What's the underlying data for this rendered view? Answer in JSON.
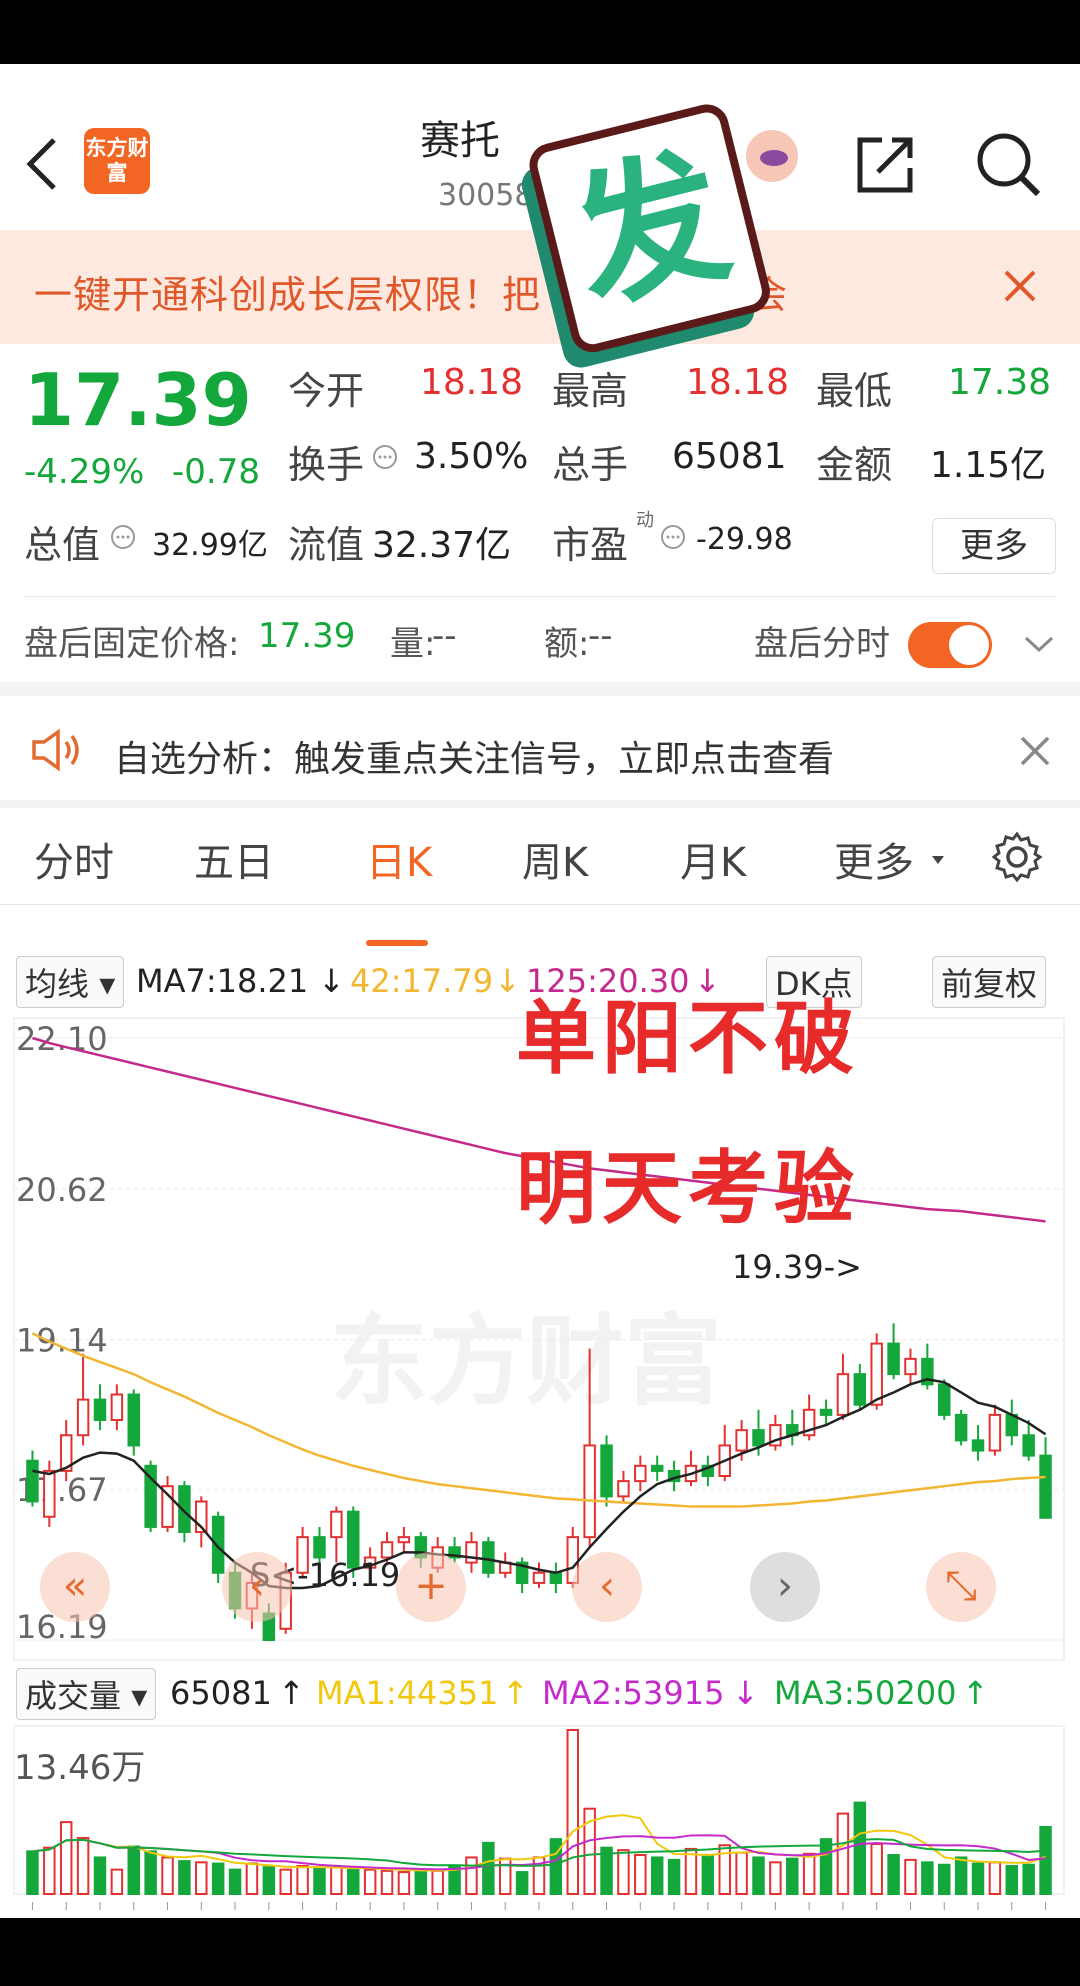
{
  "header": {
    "brand_text": "东方财富",
    "stock_name": "赛托",
    "stock_code": "30058"
  },
  "banner": {
    "text": "一键开通科创成长层权限！把 新、交易机会"
  },
  "quote": {
    "price": "17.39",
    "change_pct": "-4.29%",
    "change_amt": "-0.78",
    "open_label": "今开",
    "open_value": "18.18",
    "high_label": "最高",
    "high_value": "18.18",
    "low_label": "最低",
    "low_value": "17.38",
    "turnover_label": "换手",
    "turnover_value": "3.50%",
    "volume_label": "总手",
    "volume_value": "65081",
    "amount_label": "金额",
    "amount_value": "1.15亿",
    "mktcap_label": "总值",
    "mktcap_value": "32.99亿",
    "float_label": "流值",
    "float_value": "32.37亿",
    "pe_label": "市盈",
    "pe_sup": "动",
    "pe_value": "-29.98",
    "more_label": "更多"
  },
  "after_hours": {
    "price_label": "盘后固定价格:",
    "price_value": "17.39",
    "vol_label": "量:",
    "vol_value": "--",
    "amt_label": "额:",
    "amt_value": "--",
    "timeshare_label": "盘后分时",
    "toggle_on": true
  },
  "notice": {
    "text": "自选分析：触发重点关注信号，立即点击查看"
  },
  "tabs": [
    "分时",
    "五日",
    "日K",
    "周K",
    "月K",
    "更多"
  ],
  "active_tab": "日K",
  "ma_bar": {
    "selector": "均线",
    "ma7": "MA7:18.21",
    "ma42": "42:17.79",
    "ma125": "125:20.30",
    "dk": "DK点",
    "adjust": "前复权"
  },
  "overlay": {
    "line1": "单阳不破",
    "line2": "明天考验",
    "watermark": "东方财富",
    "sticker_text": "发"
  },
  "annotations": {
    "high_label": "19.39->",
    "low_label": "S<-16.19"
  },
  "vol_bar": {
    "selector": "成交量",
    "vol": "65081",
    "ma1": "MA1:44351",
    "ma2": "MA2:53915",
    "ma3": "MA3:50200",
    "max_label": "13.46万"
  },
  "colors": {
    "up": "#e33131",
    "down": "#14a73b",
    "accent": "#f26522",
    "ma7": "#222222",
    "ma42": "#f2b632",
    "ma125": "#c42a8c"
  },
  "chart_data": {
    "type": "candlestick",
    "ylim": [
      16.19,
      22.1
    ],
    "yticks": [
      "22.10",
      "20.62",
      "19.14",
      "17.67",
      "16.19"
    ],
    "candles": [
      [
        17.95,
        17.55,
        18.05,
        17.5
      ],
      [
        17.4,
        17.85,
        17.95,
        17.3
      ],
      [
        17.85,
        18.2,
        18.35,
        17.75
      ],
      [
        18.2,
        18.55,
        19.0,
        18.1
      ],
      [
        18.55,
        18.35,
        18.7,
        18.25
      ],
      [
        18.35,
        18.6,
        18.7,
        18.25
      ],
      [
        18.6,
        18.1,
        18.65,
        18.0
      ],
      [
        17.9,
        17.3,
        17.95,
        17.25
      ],
      [
        17.3,
        17.7,
        17.8,
        17.25
      ],
      [
        17.7,
        17.25,
        17.75,
        17.15
      ],
      [
        17.25,
        17.55,
        17.6,
        17.1
      ],
      [
        17.4,
        16.85,
        17.45,
        16.75
      ],
      [
        16.85,
        16.5,
        16.95,
        16.4
      ],
      [
        16.5,
        16.75,
        16.85,
        16.3
      ],
      [
        16.45,
        16.19,
        16.55,
        16.19
      ],
      [
        16.3,
        16.85,
        16.95,
        16.25
      ],
      [
        16.85,
        17.2,
        17.3,
        16.8
      ],
      [
        17.2,
        17.0,
        17.3,
        16.85
      ],
      [
        17.2,
        17.45,
        17.5,
        16.95
      ],
      [
        17.45,
        16.9,
        17.5,
        16.8
      ],
      [
        16.9,
        17.0,
        17.1,
        16.85
      ],
      [
        17.0,
        17.15,
        17.25,
        16.95
      ],
      [
        17.15,
        17.2,
        17.3,
        17.05
      ],
      [
        17.2,
        17.0,
        17.25,
        16.9
      ],
      [
        16.9,
        17.1,
        17.2,
        16.85
      ],
      [
        17.1,
        17.0,
        17.2,
        16.95
      ],
      [
        16.95,
        17.15,
        17.25,
        16.85
      ],
      [
        17.15,
        16.85,
        17.2,
        16.8
      ],
      [
        16.85,
        16.95,
        17.05,
        16.8
      ],
      [
        16.95,
        16.75,
        17.0,
        16.65
      ],
      [
        16.75,
        16.85,
        16.95,
        16.7
      ],
      [
        16.85,
        16.75,
        16.95,
        16.65
      ],
      [
        16.75,
        17.2,
        17.3,
        16.7
      ],
      [
        17.2,
        18.1,
        19.05,
        17.1
      ],
      [
        18.1,
        17.6,
        18.2,
        17.5
      ],
      [
        17.6,
        17.75,
        17.85,
        17.55
      ],
      [
        17.75,
        17.9,
        18.0,
        17.65
      ],
      [
        17.9,
        17.85,
        18.0,
        17.75
      ],
      [
        17.85,
        17.75,
        17.95,
        17.65
      ],
      [
        17.75,
        17.9,
        18.05,
        17.7
      ],
      [
        17.9,
        17.8,
        18.0,
        17.7
      ],
      [
        17.8,
        18.1,
        18.3,
        17.75
      ],
      [
        18.05,
        18.25,
        18.35,
        17.95
      ],
      [
        18.25,
        18.1,
        18.45,
        18.0
      ],
      [
        18.1,
        18.3,
        18.4,
        18.05
      ],
      [
        18.3,
        18.2,
        18.45,
        18.1
      ],
      [
        18.2,
        18.45,
        18.6,
        18.15
      ],
      [
        18.45,
        18.4,
        18.55,
        18.3
      ],
      [
        18.4,
        18.8,
        19.0,
        18.35
      ],
      [
        18.8,
        18.5,
        18.9,
        18.45
      ],
      [
        18.5,
        19.1,
        19.2,
        18.45
      ],
      [
        19.1,
        18.8,
        19.3,
        18.75
      ],
      [
        18.8,
        18.95,
        19.05,
        18.7
      ],
      [
        18.95,
        18.7,
        19.1,
        18.65
      ],
      [
        18.7,
        18.4,
        18.75,
        18.35
      ],
      [
        18.4,
        18.15,
        18.45,
        18.1
      ],
      [
        18.15,
        18.05,
        18.3,
        17.95
      ],
      [
        18.05,
        18.4,
        18.5,
        18.0
      ],
      [
        18.4,
        18.2,
        18.55,
        18.1
      ],
      [
        18.2,
        18.0,
        18.35,
        17.95
      ],
      [
        18.0,
        17.39,
        18.18,
        17.38
      ]
    ],
    "ma7": [
      17.85,
      17.82,
      17.88,
      17.98,
      18.03,
      18.02,
      17.95,
      17.78,
      17.62,
      17.45,
      17.3,
      17.1,
      16.95,
      16.85,
      16.72,
      16.7,
      16.7,
      16.72,
      16.8,
      16.88,
      16.92,
      16.98,
      17.05,
      17.05,
      17.03,
      17.02,
      17.0,
      16.98,
      16.95,
      16.92,
      16.88,
      16.85,
      16.9,
      17.1,
      17.28,
      17.45,
      17.6,
      17.72,
      17.78,
      17.82,
      17.88,
      17.95,
      18.02,
      18.08,
      18.15,
      18.2,
      18.25,
      18.3,
      18.38,
      18.45,
      18.55,
      18.62,
      18.7,
      18.75,
      18.72,
      18.62,
      18.52,
      18.48,
      18.4,
      18.32,
      18.21
    ],
    "ma42": [
      19.2,
      19.12,
      19.05,
      18.98,
      18.92,
      18.86,
      18.8,
      18.72,
      18.65,
      18.58,
      18.5,
      18.42,
      18.35,
      18.28,
      18.2,
      18.13,
      18.06,
      18.0,
      17.95,
      17.9,
      17.86,
      17.82,
      17.78,
      17.75,
      17.72,
      17.7,
      17.68,
      17.66,
      17.64,
      17.62,
      17.6,
      17.58,
      17.57,
      17.56,
      17.55,
      17.54,
      17.53,
      17.52,
      17.51,
      17.5,
      17.5,
      17.5,
      17.5,
      17.51,
      17.52,
      17.53,
      17.55,
      17.56,
      17.58,
      17.6,
      17.62,
      17.64,
      17.66,
      17.68,
      17.7,
      17.72,
      17.74,
      17.75,
      17.77,
      17.78,
      17.79
    ],
    "ma125": [
      22.1,
      22.05,
      22.01,
      21.97,
      21.93,
      21.89,
      21.85,
      21.81,
      21.77,
      21.73,
      21.69,
      21.65,
      21.61,
      21.57,
      21.53,
      21.49,
      21.45,
      21.41,
      21.37,
      21.33,
      21.29,
      21.25,
      21.21,
      21.17,
      21.13,
      21.09,
      21.05,
      21.01,
      20.97,
      20.94,
      20.91,
      20.88,
      20.85,
      20.82,
      20.8,
      20.78,
      20.76,
      20.74,
      20.72,
      20.7,
      20.68,
      20.66,
      20.64,
      20.62,
      20.6,
      20.58,
      20.56,
      20.54,
      20.52,
      20.5,
      20.48,
      20.46,
      20.44,
      20.42,
      20.41,
      20.4,
      20.38,
      20.36,
      20.34,
      20.32,
      20.3
    ],
    "volume": [
      3.5,
      3.8,
      5.9,
      4.6,
      3.0,
      2.0,
      3.9,
      3.5,
      3.0,
      2.7,
      2.6,
      2.5,
      2.0,
      2.5,
      2.2,
      2.0,
      2.3,
      2.1,
      2.2,
      2.0,
      2.0,
      1.9,
      1.8,
      2.0,
      1.9,
      2.3,
      3.0,
      4.2,
      2.9,
      1.8,
      3.0,
      4.5,
      13.46,
      7.0,
      3.8,
      3.6,
      3.2,
      3.0,
      2.8,
      3.7,
      3.2,
      4.0,
      3.4,
      3.0,
      2.6,
      2.9,
      3.3,
      4.5,
      6.6,
      7.5,
      4.1,
      3.2,
      2.8,
      2.6,
      2.4,
      3.0,
      2.5,
      2.6,
      2.3,
      2.4,
      5.5
    ],
    "vol_ylim": [
      0,
      13.46
    ]
  }
}
